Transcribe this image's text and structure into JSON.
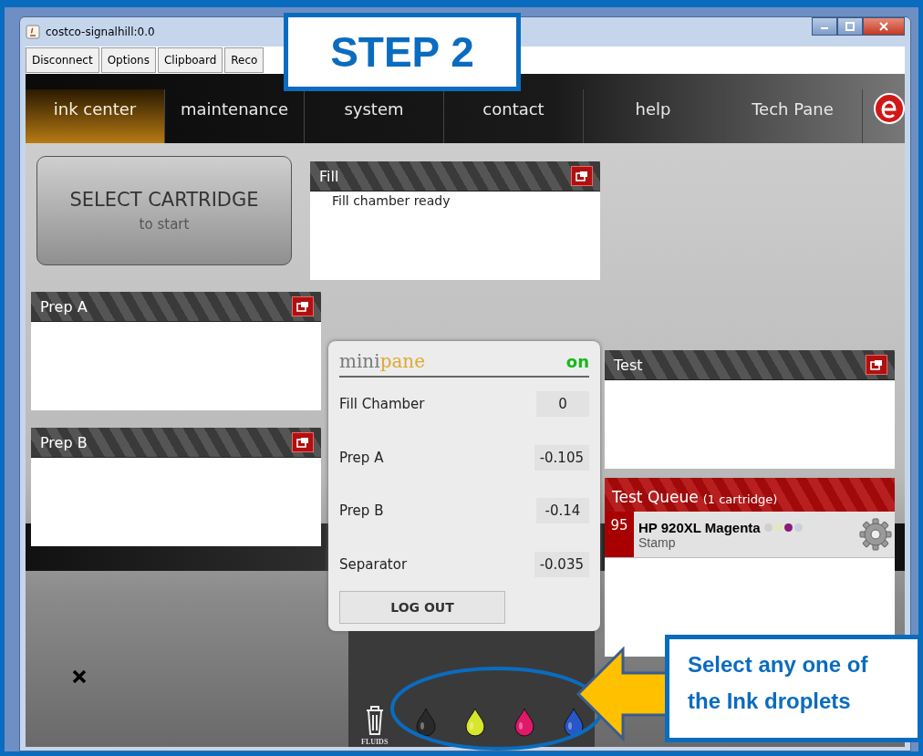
{
  "window": {
    "title": "costco-signalhill:0.0"
  },
  "toolbar": [
    "Disconnect",
    "Options",
    "Clipboard",
    "Reco"
  ],
  "nav": [
    {
      "label": "ink center",
      "selected": true
    },
    {
      "label": "maintenance",
      "selected": false
    },
    {
      "label": "system",
      "selected": false
    },
    {
      "label": "contact",
      "selected": false
    },
    {
      "label": "help",
      "selected": false
    },
    {
      "label": "Tech Pane",
      "selected": false
    }
  ],
  "start_button": {
    "title": "SELECT CARTRIDGE",
    "subtitle": "to start"
  },
  "panes": [
    {
      "title": "Fill",
      "message": "Fill chamber ready"
    },
    {
      "title": "Prep A"
    },
    {
      "title": "Prep B"
    },
    {
      "title": "Test"
    }
  ],
  "minipane": {
    "brand_a": "mini",
    "brand_b": "pane",
    "status": "on",
    "readings": [
      {
        "label": "Fill Chamber",
        "value": "0"
      },
      {
        "label": "Prep A",
        "value": "-0.105"
      },
      {
        "label": "Prep B",
        "value": "-0.14"
      },
      {
        "label": "Separator",
        "value": "-0.035"
      }
    ],
    "button": "LOG OUT"
  },
  "test_queue": {
    "title": "Test Queue",
    "count": "(1 cartridge)",
    "items": [
      {
        "number": "95",
        "name": "HP 920XL Magenta",
        "type": "Stamp",
        "inks": [
          {
            "color": "#cfcfcf"
          },
          {
            "color": "#e4e6bc"
          },
          {
            "color": "#8b1a7a"
          },
          {
            "color": "#c9cfe0"
          }
        ]
      }
    ]
  },
  "fluids": {
    "label": "FLUIDS",
    "droplets": [
      {
        "color": "#2a2a2a"
      },
      {
        "color": "#d6e62c"
      },
      {
        "color": "#e0186a"
      },
      {
        "color": "#2858c8"
      }
    ]
  },
  "annotation": {
    "step": "STEP 2",
    "callout": "Select any one of the Ink droplets"
  }
}
